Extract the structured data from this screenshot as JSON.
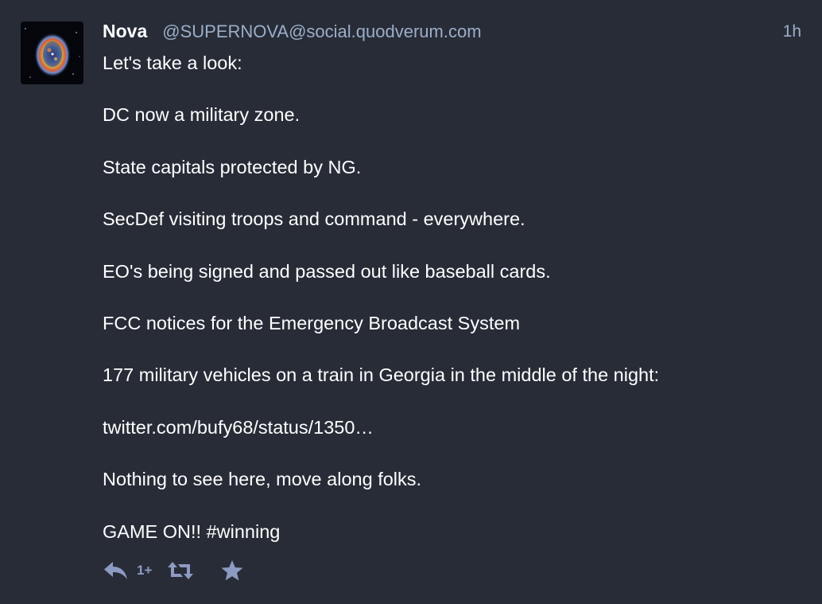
{
  "status": {
    "display_name": "Nova",
    "acct": "@SUPERNOVA@social.quodverum.com",
    "relative_time": "1h",
    "paragraphs": [
      "Let's take a look:",
      "DC now a military zone.",
      "State capitals protected by NG.",
      "SecDef visiting troops and command - everywhere.",
      "EO's being signed and passed out like baseball cards.",
      "FCC notices for the Emergency Broadcast System",
      "177 military vehicles on a train in Georgia in the middle of the night:",
      "twitter.com/bufy68/status/1350…",
      "Nothing to see here, move along folks.",
      "GAME ON!! #winning"
    ],
    "actions": {
      "reply_count": "1+",
      "reply_icon": "reply-icon",
      "reblog_icon": "retweet-icon",
      "favourite_icon": "star-icon"
    }
  },
  "colors": {
    "background": "#282c37",
    "text": "#ffffff",
    "secondary_text": "#9baec8",
    "action_icon": "#8d9ac2"
  }
}
